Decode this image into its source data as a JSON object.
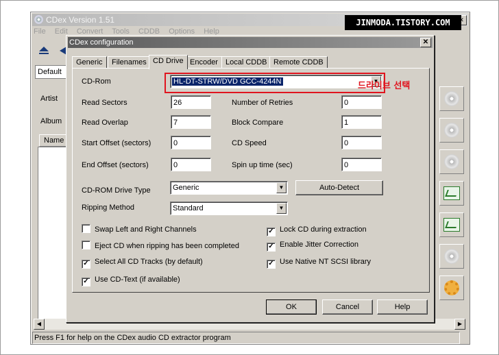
{
  "app": {
    "title": "CDex Version 1.51",
    "menu": [
      "File",
      "Edit",
      "Convert",
      "Tools",
      "CDDB",
      "Options",
      "Help"
    ],
    "preset": "Default",
    "labels": {
      "artist": "Artist",
      "album": "Album",
      "name_col": "Name"
    },
    "status": "Press F1 for help on the CDex audio CD extractor program",
    "watermark": "JINMODA.TISTORY.COM"
  },
  "dialog": {
    "title": "CDex configuration",
    "tabs": [
      "Generic",
      "Filenames",
      "CD Drive",
      "Encoder",
      "Local CDDB",
      "Remote CDDB"
    ],
    "active_tab": "CD Drive",
    "cdrom": {
      "label": "CD-Rom",
      "value": "HL-DT-STRW/DVD GCC-4244N"
    },
    "annotation": "드라이브 선택",
    "fields": {
      "read_sectors": {
        "label": "Read Sectors",
        "value": "26"
      },
      "read_overlap": {
        "label": "Read Overlap",
        "value": "7"
      },
      "start_offset": {
        "label": "Start Offset (sectors)",
        "value": "0"
      },
      "end_offset": {
        "label": "End Offset (sectors)",
        "value": "0"
      },
      "num_retries": {
        "label": "Number of Retries",
        "value": "0"
      },
      "block_compare": {
        "label": "Block Compare",
        "value": "1"
      },
      "cd_speed": {
        "label": "CD Speed",
        "value": "0"
      },
      "spin_up": {
        "label": "Spin up time (sec)",
        "value": "0"
      }
    },
    "drive_type": {
      "label": "CD-ROM Drive Type",
      "value": "Generic"
    },
    "ripping": {
      "label": "Ripping Method",
      "value": "Standard"
    },
    "auto_detect": "Auto-Detect",
    "checks": {
      "swap": {
        "label": "Swap Left and Right Channels",
        "checked": false
      },
      "eject": {
        "label": "Eject CD when ripping has been completed",
        "checked": false
      },
      "select_all": {
        "label": "Select All CD Tracks (by default)",
        "checked": true
      },
      "cd_text": {
        "label": "Use CD-Text (if available)",
        "checked": true
      },
      "lock_cd": {
        "label": "Lock CD during extraction",
        "checked": true
      },
      "jitter": {
        "label": "Enable Jitter Correction",
        "checked": true
      },
      "native_scsi": {
        "label": "Use Native NT SCSI library",
        "checked": true
      }
    },
    "buttons": {
      "ok": "OK",
      "cancel": "Cancel",
      "help": "Help"
    }
  }
}
